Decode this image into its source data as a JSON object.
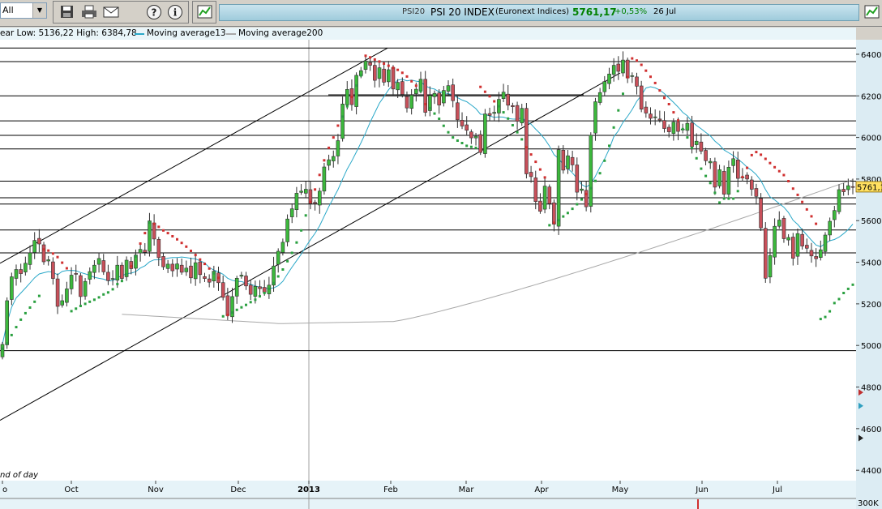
{
  "toolbar": {
    "period_value": "All",
    "info_symbol": "PSI20",
    "info_name": "PSI 20 INDEX",
    "info_exchange": "(Euronext Indices)",
    "info_price": "5761,17",
    "info_change": "+0,53%",
    "info_date": "26 Jul",
    "icons": [
      "save-icon",
      "print-icon",
      "email-icon",
      "help-icon",
      "info-icon",
      "chart-icon"
    ],
    "colors": {
      "price": "#008000",
      "change": "#008000"
    }
  },
  "legend": {
    "range_text": "ear Low: 5136,22 High: 6384,78",
    "ma13_label": "Moving average13",
    "ma200_label": "Moving average200",
    "colors": {
      "ma13": "#2aa8c8",
      "ma200": "#a8a8a8"
    }
  },
  "chart_data": {
    "type": "candlestick",
    "y_ticks": [
      "6400",
      "6200",
      "6000",
      "5800",
      "5600",
      "5400",
      "5200",
      "5000",
      "4800",
      "4600",
      "4400"
    ],
    "x_ticks": [
      "o",
      "Oct",
      "Nov",
      "Dec",
      "2013",
      "Feb",
      "Mar",
      "Apr",
      "May",
      "Jun",
      "Jul"
    ],
    "ylim": [
      4350,
      6470
    ],
    "last_price_label": "5761,17",
    "volume_label": "300K",
    "footer_label": "nd of day",
    "horizontal_levels": [
      6430,
      6365,
      6200,
      6080,
      6010,
      5945,
      5790,
      5710,
      5680,
      5555,
      5445,
      4975
    ],
    "colors": {
      "up": "#3cb83c",
      "down": "#c8505a",
      "sar_up": "#2aa040",
      "sar_down": "#d03030",
      "last_label_bg": "#ffe060"
    },
    "closes": [
      5005,
      5215,
      5330,
      5365,
      5345,
      5395,
      5445,
      5505,
      5488,
      5402,
      5412,
      5322,
      5188,
      5215,
      5272,
      5338,
      5342,
      5235,
      5308,
      5355,
      5386,
      5418,
      5354,
      5312,
      5322,
      5386,
      5322,
      5410,
      5369,
      5435,
      5462,
      5448,
      5599,
      5512,
      5422,
      5378,
      5391,
      5359,
      5392,
      5352,
      5372,
      5325,
      5398,
      5341,
      5322,
      5304,
      5357,
      5302,
      5231,
      5144,
      5235,
      5323,
      5338,
      5286,
      5246,
      5284,
      5273,
      5256,
      5290,
      5382,
      5453,
      5496,
      5608,
      5657,
      5732,
      5742,
      5751,
      5682,
      5683,
      5742,
      5858,
      5893,
      5909,
      5985,
      6161,
      6231,
      6158,
      6299,
      6321,
      6368,
      6347,
      6275,
      6335,
      6266,
      6326,
      6233,
      6265,
      6207,
      6142,
      6204,
      6232,
      6280,
      6121,
      6202,
      6212,
      6156,
      6226,
      6249,
      6177,
      6085,
      6055,
      6035,
      5998,
      6006,
      5928,
      6113,
      6106,
      6121,
      6183,
      6218,
      6155,
      6148,
      6078,
      6140,
      5825,
      5812,
      5692,
      5645,
      5766,
      5682,
      5583,
      5941,
      5843,
      5912,
      5868,
      5737,
      5752,
      5667,
      6011,
      6172,
      6216,
      6269,
      6305,
      6347,
      6318,
      6372,
      6286,
      6297,
      6246,
      6136,
      6117,
      6092,
      6099,
      6084,
      6043,
      6027,
      6074,
      6029,
      6040,
      6068,
      5955,
      5982,
      5934,
      5888,
      5885,
      5761,
      5845,
      5727,
      5857,
      5898,
      5803,
      5809,
      5800,
      5751,
      5717,
      5565,
      5323,
      5433,
      5573,
      5603,
      5513,
      5519,
      5419,
      5538,
      5478,
      5467,
      5430,
      5417,
      5460,
      5531,
      5597,
      5649,
      5749,
      5739,
      5768,
      5761
    ],
    "sar": [
      4985,
      5010,
      5050,
      5088,
      5124,
      5155,
      5182,
      5210,
      5238,
      5462,
      5456,
      5442,
      5425,
      5398,
      5371,
      5165,
      5177,
      5190,
      5200,
      5210,
      5220,
      5231,
      5245,
      5255,
      5270,
      5295,
      5310,
      5342,
      5380,
      5428,
      5490,
      5540,
      5590,
      5585,
      5570,
      5553,
      5540,
      5525,
      5510,
      5493,
      5475,
      5455,
      5435,
      5413,
      5392,
      5370,
      5347,
      5325,
      5140,
      5146,
      5158,
      5171,
      5183,
      5195,
      5208,
      5220,
      5236,
      5252,
      5272,
      5300,
      5332,
      5365,
      5405,
      5445,
      5495,
      5553,
      5625,
      5690,
      5750,
      5820,
      5890,
      5950,
      6000,
      6057,
      6100,
      6150,
      6195,
      6250,
      6298,
      6393,
      6385,
      6375,
      6365,
      6355,
      6345,
      6335,
      6325,
      6311,
      6293,
      6270,
      6249,
      6222,
      6160,
      6141,
      6115,
      6090,
      6056,
      6025,
      6000,
      5985,
      5973,
      5960,
      5955,
      5950,
      6243,
      6220,
      6198,
      6174,
      6150,
      6121,
      6091,
      6059,
      6025,
      5991,
      5953,
      5918,
      5883,
      5846,
      5808,
      5578,
      5590,
      5602,
      5620,
      5637,
      5657,
      5679,
      5702,
      5728,
      5756,
      5791,
      5828,
      5888,
      5960,
      6048,
      6130,
      6210,
      6290,
      6380,
      6370,
      6349,
      6321,
      6292,
      6262,
      6226,
      6190,
      6160,
      6121,
      6082,
      6040,
      6000,
      5950,
      5900,
      5850,
      5815,
      5781,
      5734,
      5687,
      5706,
      5706,
      5706,
      5742,
      5810,
      5854,
      5915,
      5930,
      5917,
      5897,
      5877,
      5857,
      5838,
      5819,
      5790,
      5754,
      5724,
      5690,
      5654,
      5621,
      5585,
      5127,
      5137,
      5164,
      5204,
      5223,
      5252,
      5272,
      5292,
      5316,
      5358,
      5400
    ]
  }
}
